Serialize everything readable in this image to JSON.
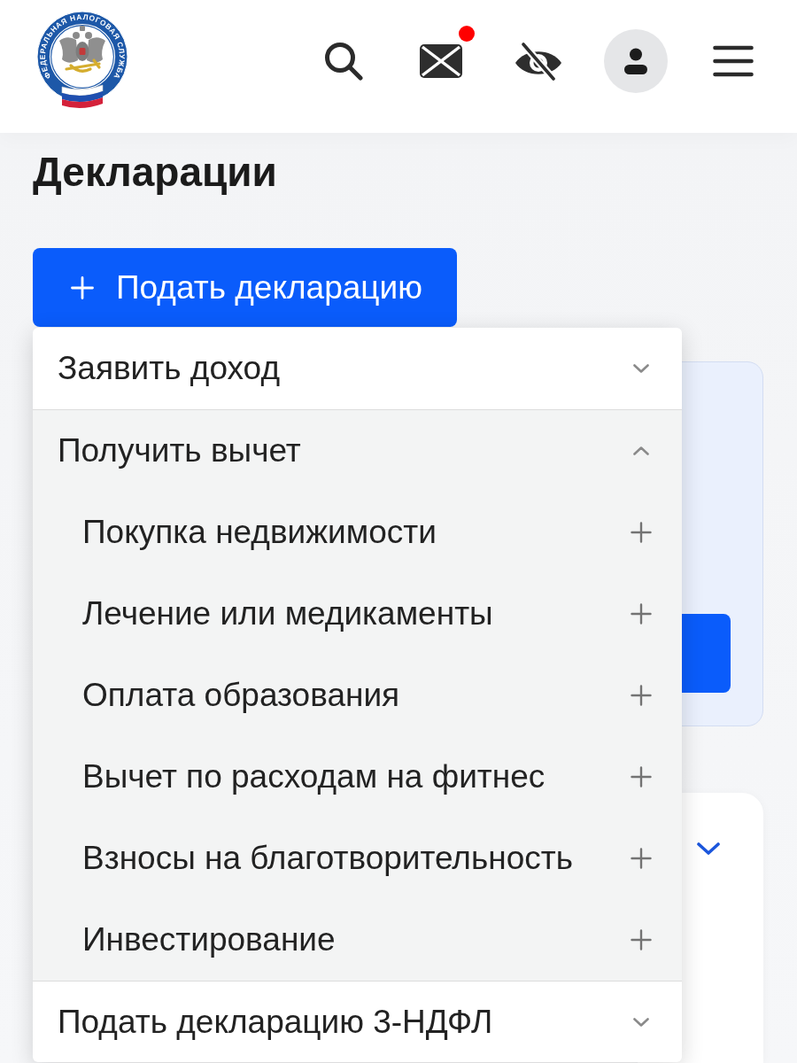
{
  "header": {
    "logo_text": "ФЕДЕРАЛЬНАЯ НАЛОГОВАЯ СЛУЖБА",
    "mail": {
      "unread": true
    }
  },
  "page_title": "Декларации",
  "primary_button": {
    "label": "Подать декларацию"
  },
  "menu": {
    "items": [
      {
        "label": "Заявить доход",
        "expanded": false
      },
      {
        "label": "Получить вычет",
        "expanded": true,
        "children": [
          {
            "label": "Покупка недвижимости"
          },
          {
            "label": "Лечение или медикаменты"
          },
          {
            "label": "Оплата образования"
          },
          {
            "label": "Вычет по расходам на фитнес"
          },
          {
            "label": "Взносы на благотворительность"
          },
          {
            "label": "Инвестирование"
          }
        ]
      },
      {
        "label": "Подать декларацию 3-НДФЛ",
        "expanded": false
      }
    ]
  },
  "cards": [
    {
      "kind": "action"
    },
    {
      "kind": "collapsible",
      "expanded": false
    }
  ]
}
